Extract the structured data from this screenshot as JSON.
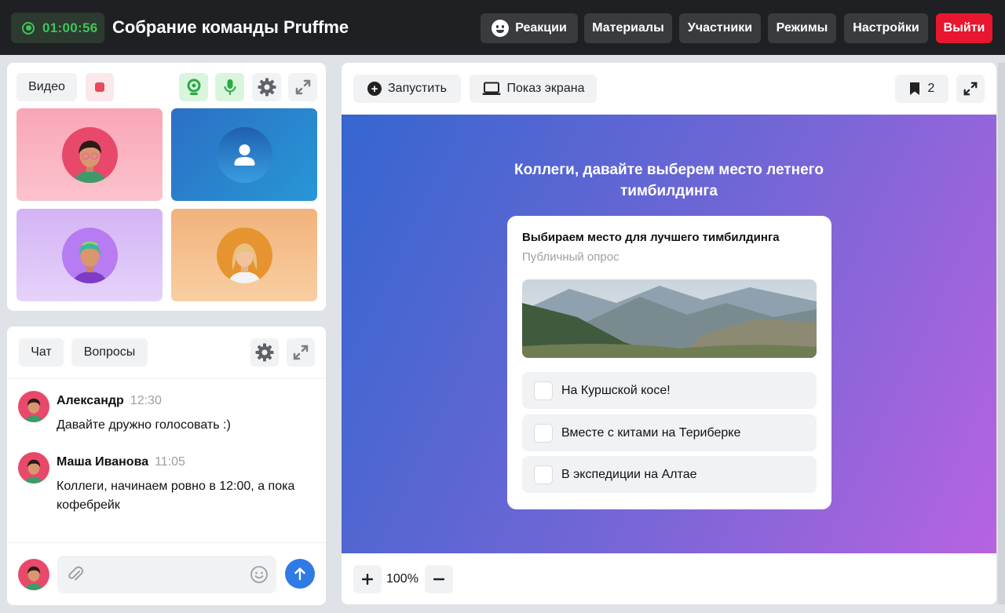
{
  "header": {
    "timer": "01:00:56",
    "title": "Собрание команды Pruffme",
    "buttons": {
      "reactions": "Реакции",
      "materials": "Материалы",
      "participants": "Участники",
      "modes": "Режимы",
      "settings": "Настройки",
      "exit": "Выйти"
    }
  },
  "video": {
    "tab_label": "Видео",
    "icons": [
      "record-icon",
      "webcam-icon",
      "mic-icon",
      "gear-icon",
      "expand-icon"
    ],
    "tiles": [
      "participant-1",
      "participant-2-no-video",
      "participant-3",
      "participant-4"
    ]
  },
  "chat": {
    "tabs": {
      "chat": "Чат",
      "questions": "Вопросы"
    },
    "messages": [
      {
        "author": "Александр",
        "time": "12:30",
        "text": "Давайте дружно голосовать :)"
      },
      {
        "author": "Маша Иванова",
        "time": "11:05",
        "text": "Коллеги, начинаем ровно в 12:00, а пока кофебрейк"
      }
    ],
    "input_placeholder": ""
  },
  "presentation": {
    "toolbar": {
      "launch": "Запустить",
      "screen_share": "Показ экрана",
      "bookmark_count": "2"
    },
    "slide_title": "Коллеги, давайте выберем место летнего тимбилдинга",
    "poll": {
      "title": "Выбираем место для лучшего тимбилдинга",
      "subtitle": "Публичный опрос",
      "options": [
        "На Куршской косе!",
        "Вместе с китами на Териберке",
        "В экспедиции на Алтае"
      ]
    },
    "zoom": "100%"
  },
  "colors": {
    "header_bg": "#1f2023",
    "timer_green": "#3fc45a",
    "exit_red": "#e8162f",
    "send_blue": "#2f7be5",
    "slide_gradient_start": "#3566cf",
    "slide_gradient_end": "#b763e0"
  }
}
